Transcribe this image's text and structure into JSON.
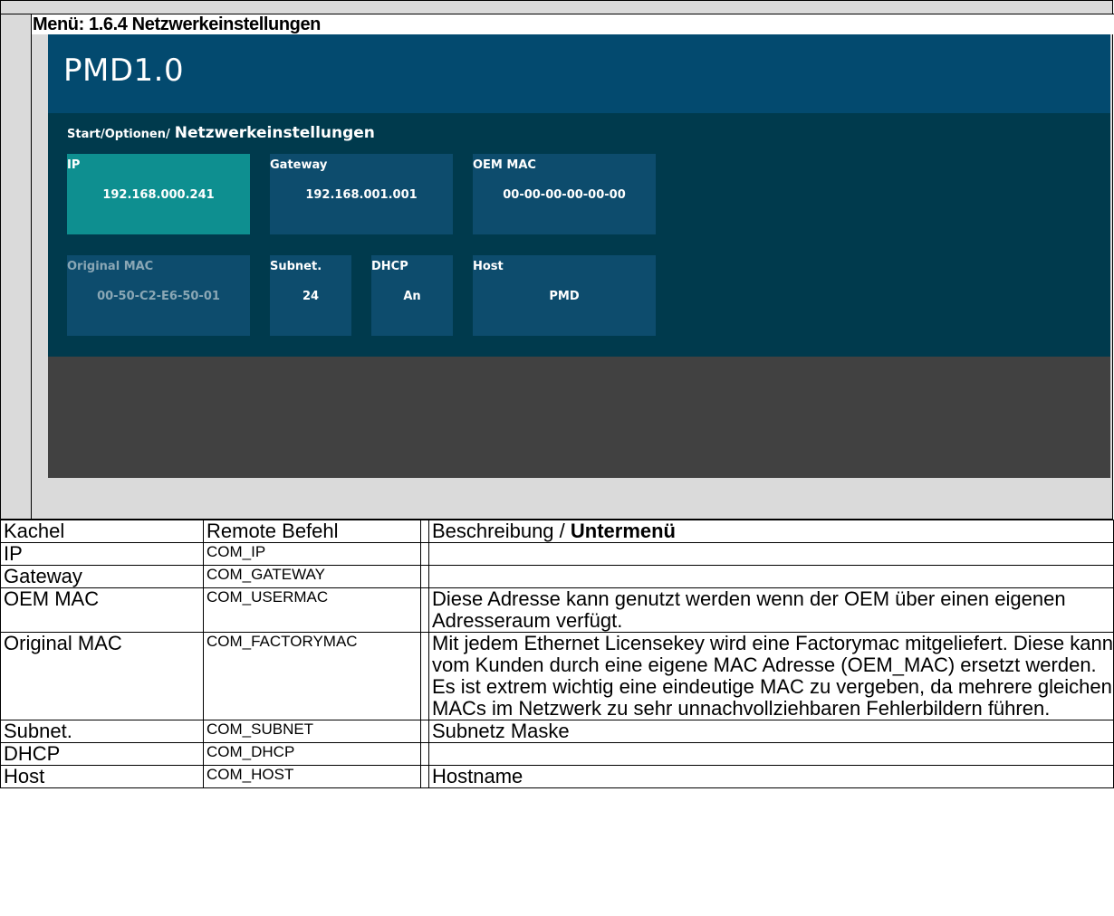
{
  "menu_title": "Menü: 1.6.4 Netzwerkeinstellungen",
  "app": {
    "title": "PMD1.0",
    "breadcrumb": {
      "path": "Start/Optionen/",
      "current": "Netzwerkeinstellungen"
    },
    "tiles": [
      {
        "id": "ip",
        "label": "IP",
        "value": "192.168.000.241",
        "state": "active"
      },
      {
        "id": "gateway",
        "label": "Gateway",
        "value": "192.168.001.001",
        "state": "normal"
      },
      {
        "id": "oem-mac",
        "label": "OEM MAC",
        "value": "00-00-00-00-00-00",
        "state": "normal"
      },
      {
        "id": "original-mac",
        "label": "Original MAC",
        "value": "00-50-C2-E6-50-01",
        "state": "disabled"
      },
      {
        "id": "subnet",
        "label": "Subnet.",
        "value": "24",
        "state": "normal"
      },
      {
        "id": "dhcp",
        "label": "DHCP",
        "value": "An",
        "state": "normal"
      },
      {
        "id": "host",
        "label": "Host",
        "value": "PMD",
        "state": "normal"
      }
    ],
    "colors": {
      "header": "#034a6f",
      "body": "#003a4d",
      "tile": "#0d4c6d",
      "tile_active": "#0e8f90",
      "footer": "#414141"
    }
  },
  "table": {
    "headers": {
      "kachel": "Kachel",
      "remote": "Remote Befehl",
      "desc": "Beschreibung / ",
      "desc_bold": "Untermenü"
    },
    "rows": [
      {
        "kachel": "IP",
        "remote": "COM_IP",
        "desc": ""
      },
      {
        "kachel": "Gateway",
        "remote": "COM_GATEWAY",
        "desc": ""
      },
      {
        "kachel": "OEM MAC",
        "remote": "COM_USERMAC",
        "desc": "Diese Adresse kann genutzt werden wenn der OEM über einen eigenen Adresseraum verfügt."
      },
      {
        "kachel": "Original MAC",
        "remote": "COM_FACTORYMAC",
        "desc": "Mit jedem Ethernet Licensekey wird eine Factorymac mitgeliefert. Diese kann vom Kunden durch eine eigene MAC Adresse (OEM_MAC) ersetzt werden. Es ist extrem wichtig eine eindeutige MAC zu vergeben, da mehrere gleichen MACs im Netzwerk zu sehr unnachvollziehbaren Fehlerbildern führen."
      },
      {
        "kachel": "Subnet.",
        "remote": "COM_SUBNET",
        "desc": "Subnetz Maske"
      },
      {
        "kachel": "DHCP",
        "remote": "COM_DHCP",
        "desc": ""
      },
      {
        "kachel": "Host",
        "remote": "COM_HOST",
        "desc": "Hostname"
      }
    ]
  }
}
